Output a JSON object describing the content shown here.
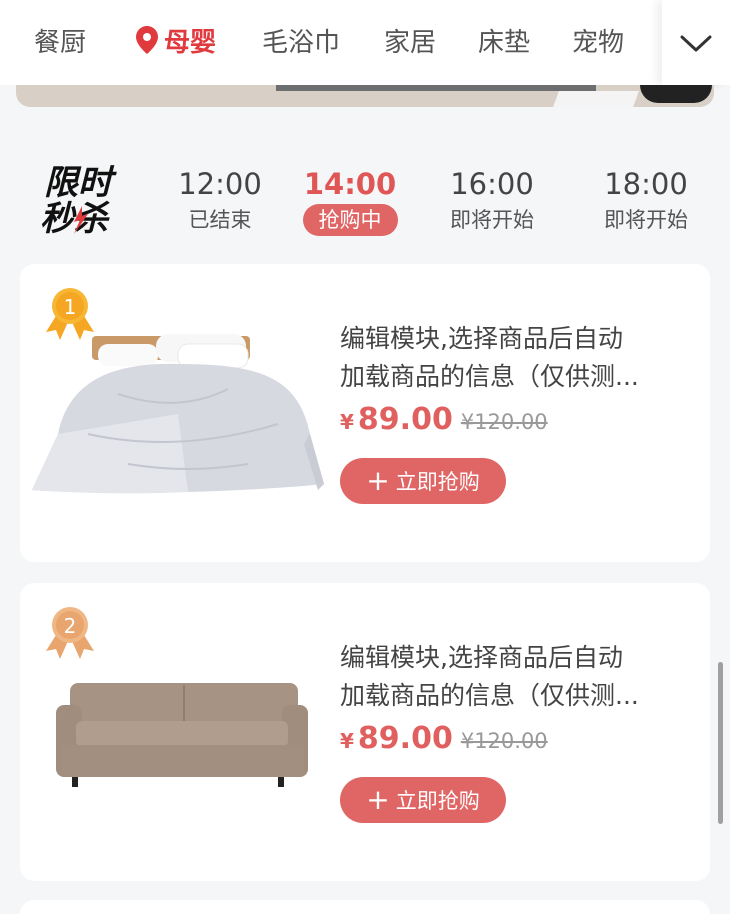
{
  "nav": {
    "items": [
      {
        "label": "餐厨",
        "active": false
      },
      {
        "label": "母婴",
        "active": true
      },
      {
        "label": "毛浴巾",
        "active": false
      },
      {
        "label": "家居",
        "active": false
      },
      {
        "label": "床垫",
        "active": false
      },
      {
        "label": "宠物",
        "active": false
      }
    ],
    "active_icon": "location-pin-icon",
    "more_icon": "chevron-down-icon"
  },
  "flash_sale": {
    "logo_text_line1": "限时",
    "logo_text_line2": "秒杀",
    "slots": [
      {
        "time": "12:00",
        "state": "已结束",
        "active": false
      },
      {
        "time": "14:00",
        "state": "抢购中",
        "active": true
      },
      {
        "time": "16:00",
        "state": "即将开始",
        "active": false
      },
      {
        "time": "18:00",
        "state": "即将开始",
        "active": false
      }
    ]
  },
  "products": [
    {
      "rank": "1",
      "title_line1": "编辑模块,选择商品后自动",
      "title_line2": "加载商品的信息（仅供测...",
      "currency": "¥",
      "price": "89.00",
      "original_price": "¥120.00",
      "button_plus": "+",
      "button_label": "立即抢购",
      "image": "duvet-bed-image"
    },
    {
      "rank": "2",
      "title_line1": "编辑模块,选择商品后自动",
      "title_line2": "加载商品的信息（仅供测...",
      "currency": "¥",
      "price": "89.00",
      "original_price": "¥120.00",
      "button_plus": "+",
      "button_label": "立即抢购",
      "image": "sofa-image"
    }
  ],
  "colors": {
    "accent": "#e06565",
    "nav_active": "#e0393e",
    "gold_badge": "#f5a623",
    "bronze_badge": "#e8a56e"
  }
}
